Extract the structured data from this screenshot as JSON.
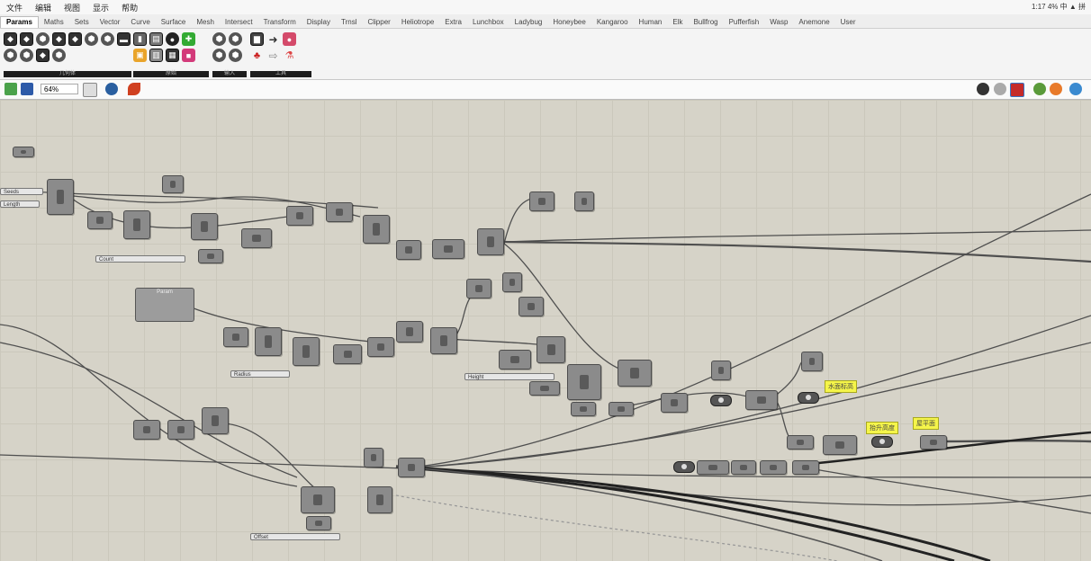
{
  "menubar": {
    "items": [
      "文件",
      "编辑",
      "视图",
      "显示",
      "帮助"
    ],
    "clock": "1:17 4% 中 ▲ 拼"
  },
  "tabs": [
    "Params",
    "Maths",
    "Sets",
    "Vector",
    "Curve",
    "Surface",
    "Mesh",
    "Intersect",
    "Transform",
    "Display",
    "Trnsl",
    "Clipper",
    "Heliotrope",
    "Extra",
    "Lunchbox",
    "Ladybug",
    "Honeybee",
    "Kangaroo",
    "Human",
    "Elk",
    "Bullfrog",
    "Pufferfish",
    "Wasp",
    "Anemone",
    "User"
  ],
  "ribbon": {
    "groups": [
      {
        "label": "几何体"
      },
      {
        "label": "原始"
      },
      {
        "label": "输入"
      },
      {
        "label": "工具"
      }
    ]
  },
  "toolbar": {
    "zoom": "64%"
  },
  "canvas": {
    "notes": [
      "水面标高",
      "抬升高度",
      "屋平面"
    ],
    "sliders": [
      "Seeds",
      "Length",
      "Count",
      "Radius",
      "Height",
      "Offset"
    ],
    "panel_title": "Param"
  },
  "colors": {
    "canvas": "#d6d3c8",
    "node": "#8b8b8b",
    "note": "#f5f54a",
    "wire": "#555555"
  }
}
